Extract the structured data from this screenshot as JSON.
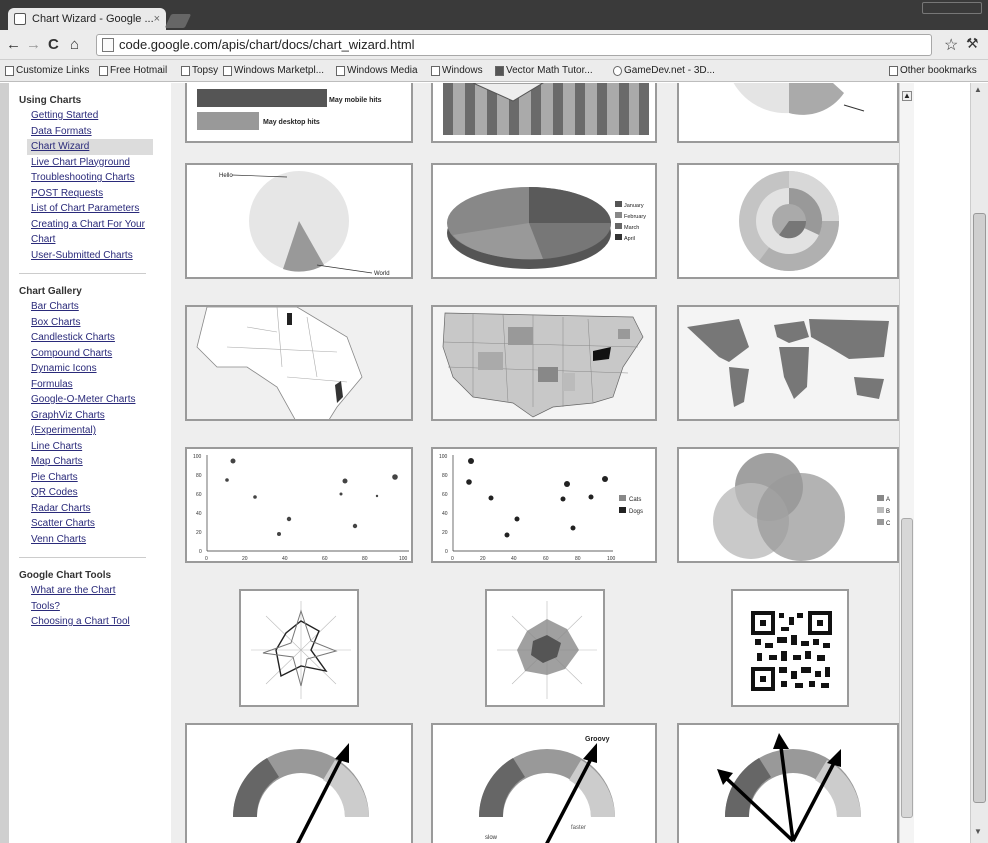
{
  "window": {
    "tab_title": "Chart Wizard - Google ...",
    "tab_close": "×"
  },
  "toolbar": {
    "back": "←",
    "forward": "→",
    "reload": "C",
    "home": "⌂",
    "url": "code.google.com/apis/chart/docs/chart_wizard.html",
    "star": "☆",
    "wrench": "🔧"
  },
  "bookmarks": {
    "items": [
      "Customize Links",
      "Free Hotmail",
      "Topsy",
      "Windows Marketpl...",
      "Windows Media",
      "Windows",
      "Vector Math Tutor...",
      "GameDev.net - 3D..."
    ],
    "other": "Other bookmarks"
  },
  "sidebar": {
    "section1_title": "Using Charts",
    "section1_items": [
      "Getting Started",
      "Data Formats",
      "Chart Wizard",
      "Live Chart Playground",
      "Troubleshooting Charts",
      "POST Requests",
      "List of Chart Parameters",
      "Creating a Chart For Your Chart",
      "User-Submitted Charts"
    ],
    "section2_title": "Chart Gallery",
    "section2_items": [
      "Bar Charts",
      "Box Charts",
      "Candlestick Charts",
      "Compound Charts",
      "Dynamic Icons",
      "Formulas",
      "Google-O-Meter Charts",
      "GraphViz Charts (Experimental)",
      "Line Charts",
      "Map Charts",
      "Pie Charts",
      "QR Codes",
      "Radar Charts",
      "Scatter Charts",
      "Venn Charts"
    ],
    "section3_title": "Google Chart Tools",
    "section3_items": [
      "What are the Chart Tools?",
      "Choosing a Chart Tool"
    ]
  },
  "gallery": {
    "bar_labels": [
      "May mobile hits",
      "May desktop hits"
    ],
    "pie_labels": [
      "Hello",
      "World"
    ],
    "pie3d_legend": [
      "January",
      "February",
      "March",
      "April"
    ],
    "scatter_axis_y": [
      "100",
      "80",
      "60",
      "40",
      "20",
      "0"
    ],
    "scatter_axis_x": [
      "0",
      "20",
      "40",
      "60",
      "80",
      "100"
    ],
    "scatter_legend": [
      "Cats",
      "Dogs"
    ],
    "venn_legend": [
      "A",
      "B",
      "C"
    ],
    "meter_labels": [
      "Groovy",
      "slow",
      "faster"
    ]
  },
  "colors": {
    "accent": "#666666",
    "link": "#2a2a7a"
  }
}
